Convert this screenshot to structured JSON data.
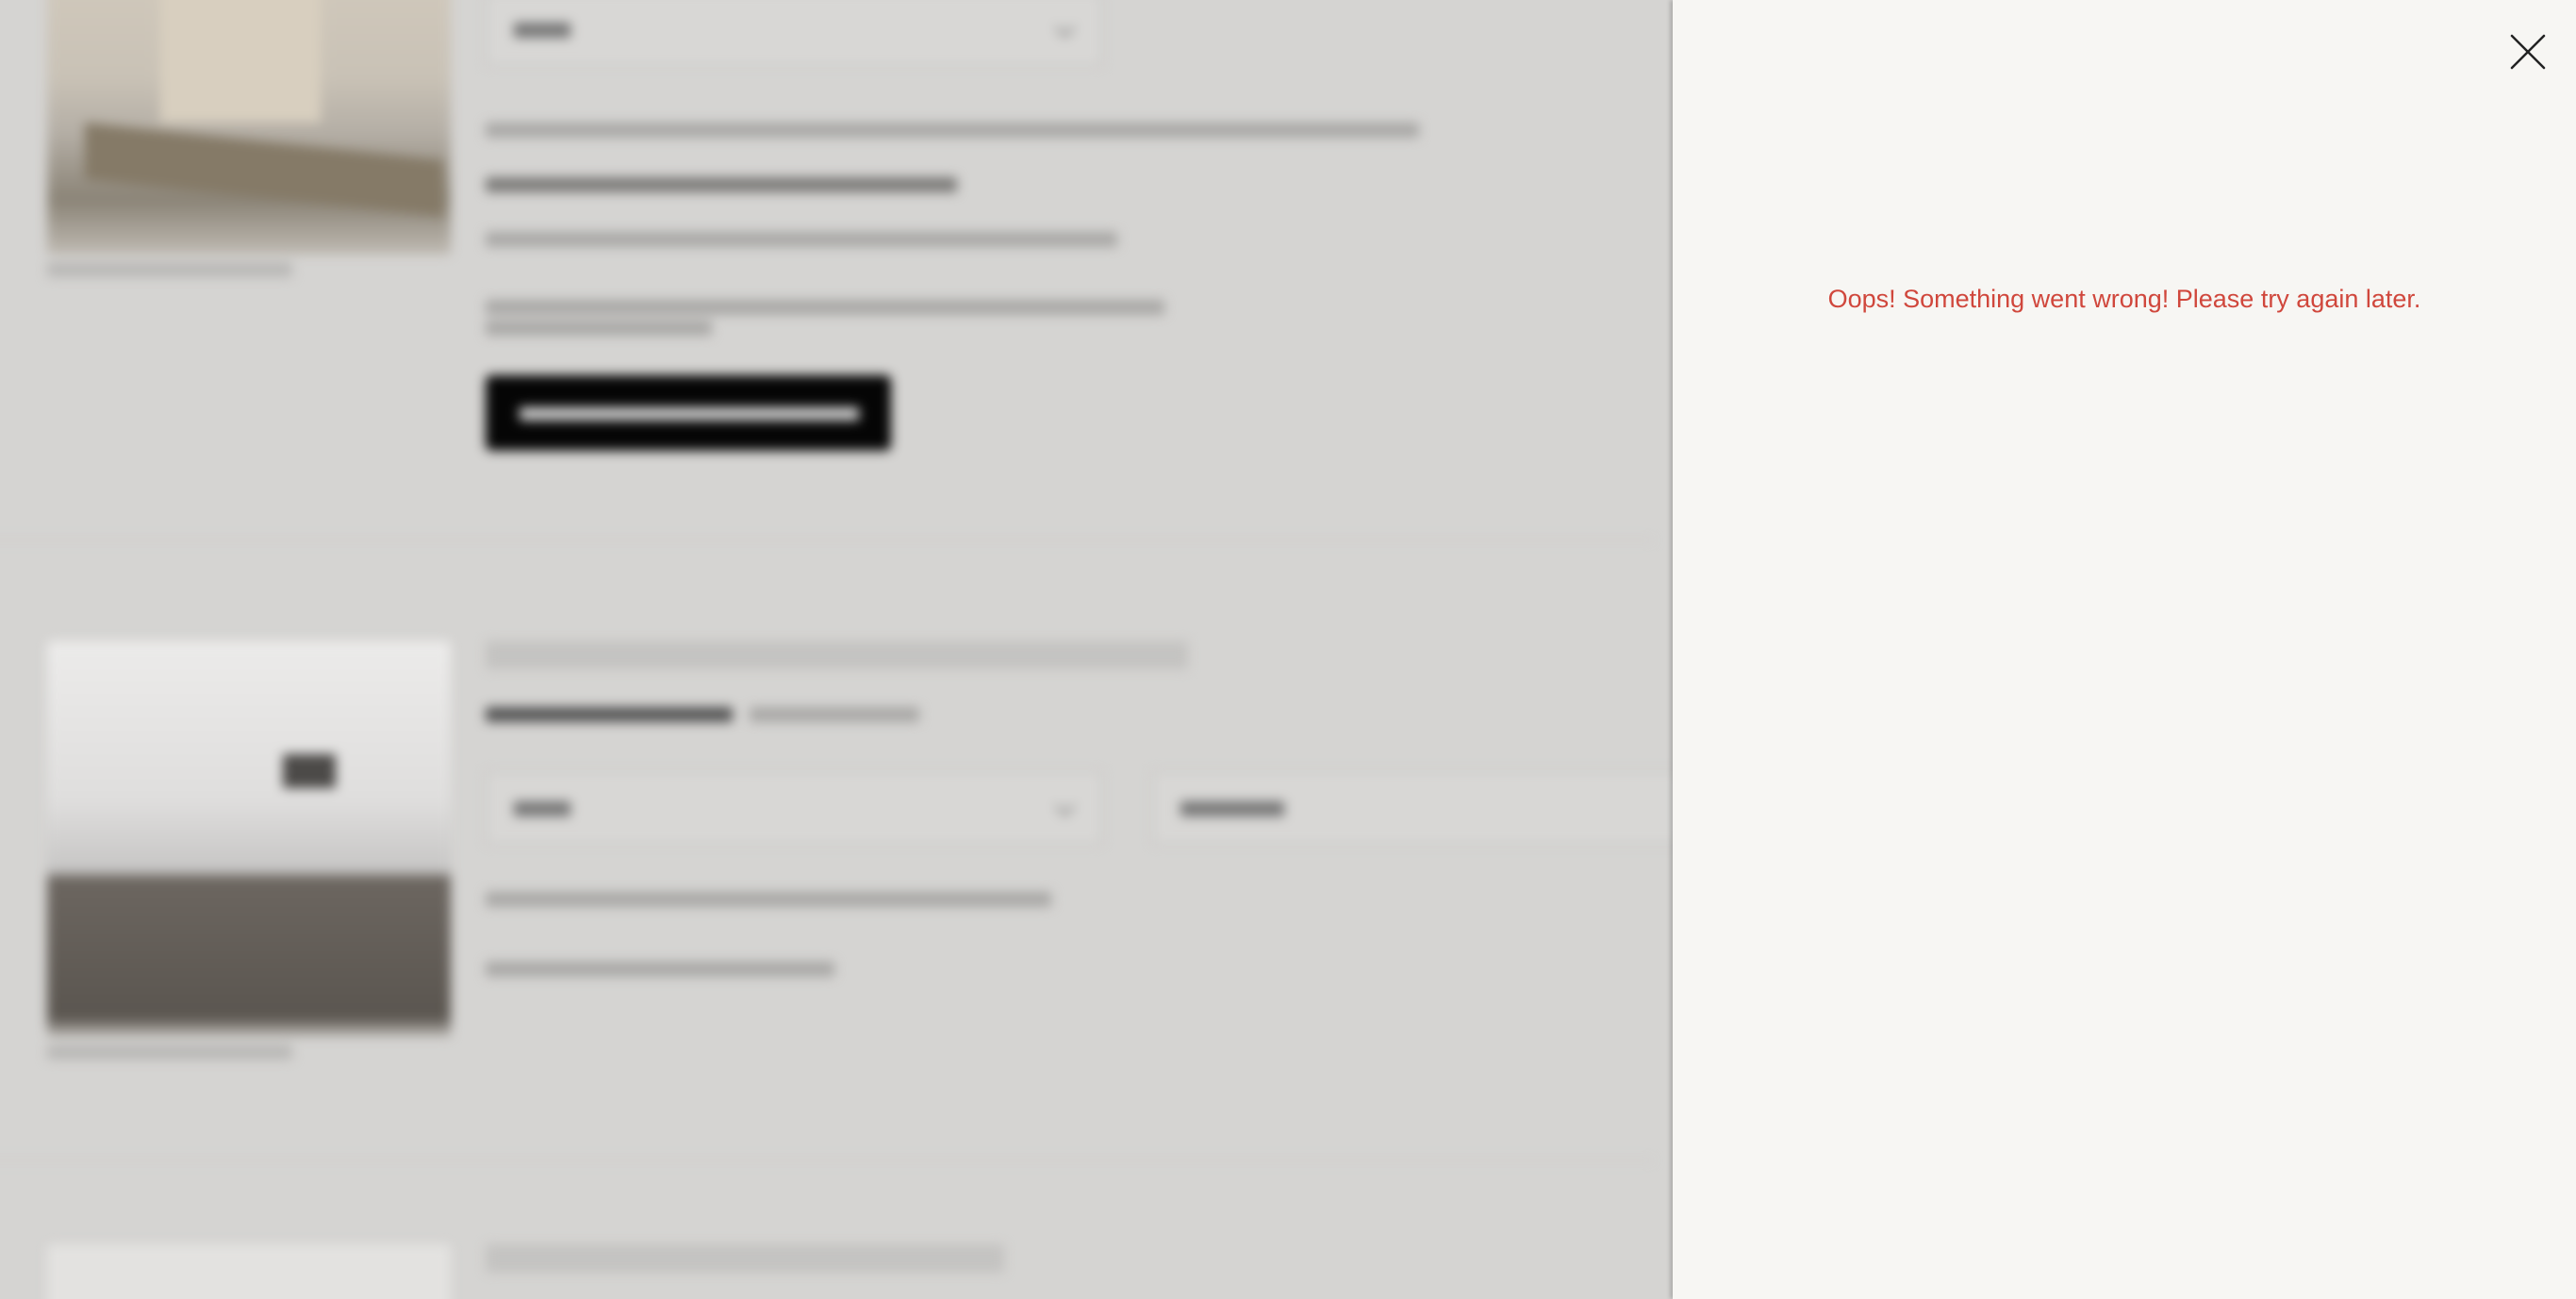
{
  "drawer": {
    "close_icon": "close-icon",
    "error_message": "Oops! Something went wrong! Please try again later."
  },
  "colors": {
    "error_text": "#d0473c",
    "drawer_background": "#f7f6f3",
    "backdrop": "#d5d4d2"
  }
}
